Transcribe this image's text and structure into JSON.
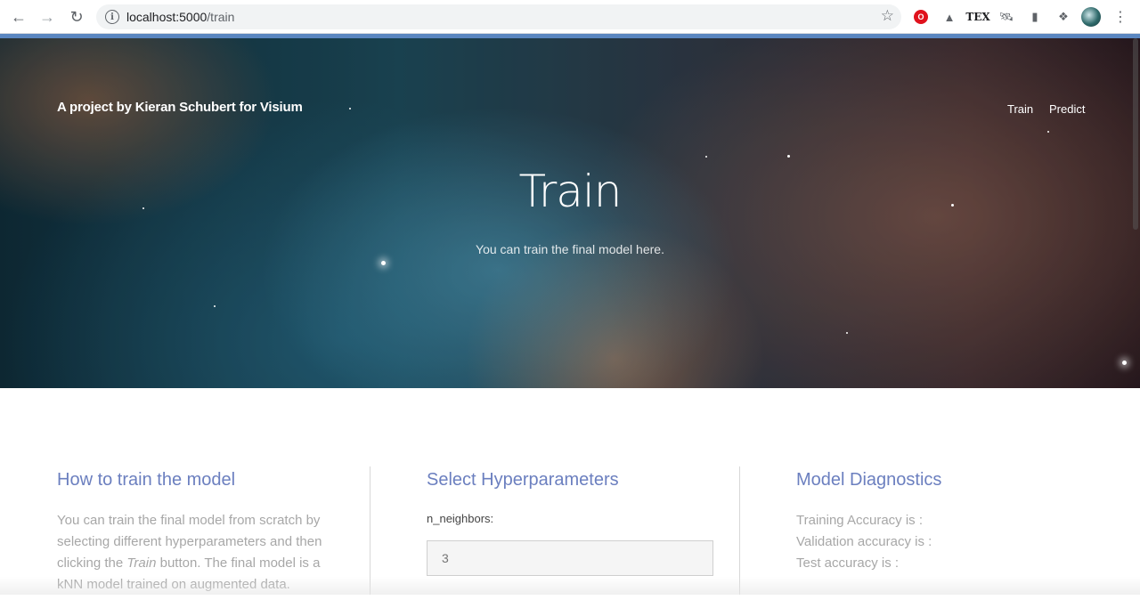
{
  "browser": {
    "url_host": "localhost:5000",
    "url_path": "/train",
    "back_icon": "arrow-left-icon",
    "forward_icon": "arrow-right-icon",
    "reload_icon": "reload-icon",
    "tex_label": "TEX"
  },
  "header": {
    "brand": "A project by Kieran Schubert for Visium",
    "nav": [
      "Train",
      "Predict"
    ]
  },
  "hero": {
    "title": "Train",
    "subtitle": "You can train the final model here."
  },
  "howto": {
    "title": "How to train the model",
    "text_before": "You can train the final model from scratch by selecting different hyperparameters and then clicking the ",
    "text_em": "Train",
    "text_after": " button. The final model is a kNN model trained on augmented data."
  },
  "hyperparameters": {
    "title": "Select Hyperparameters",
    "n_neighbors_label": "n_neighbors:",
    "n_neighbors_placeholder": "3"
  },
  "diagnostics": {
    "title": "Model Diagnostics",
    "training": "Training Accuracy is :",
    "validation": "Validation accuracy is :",
    "test": "Test accuracy is :"
  }
}
